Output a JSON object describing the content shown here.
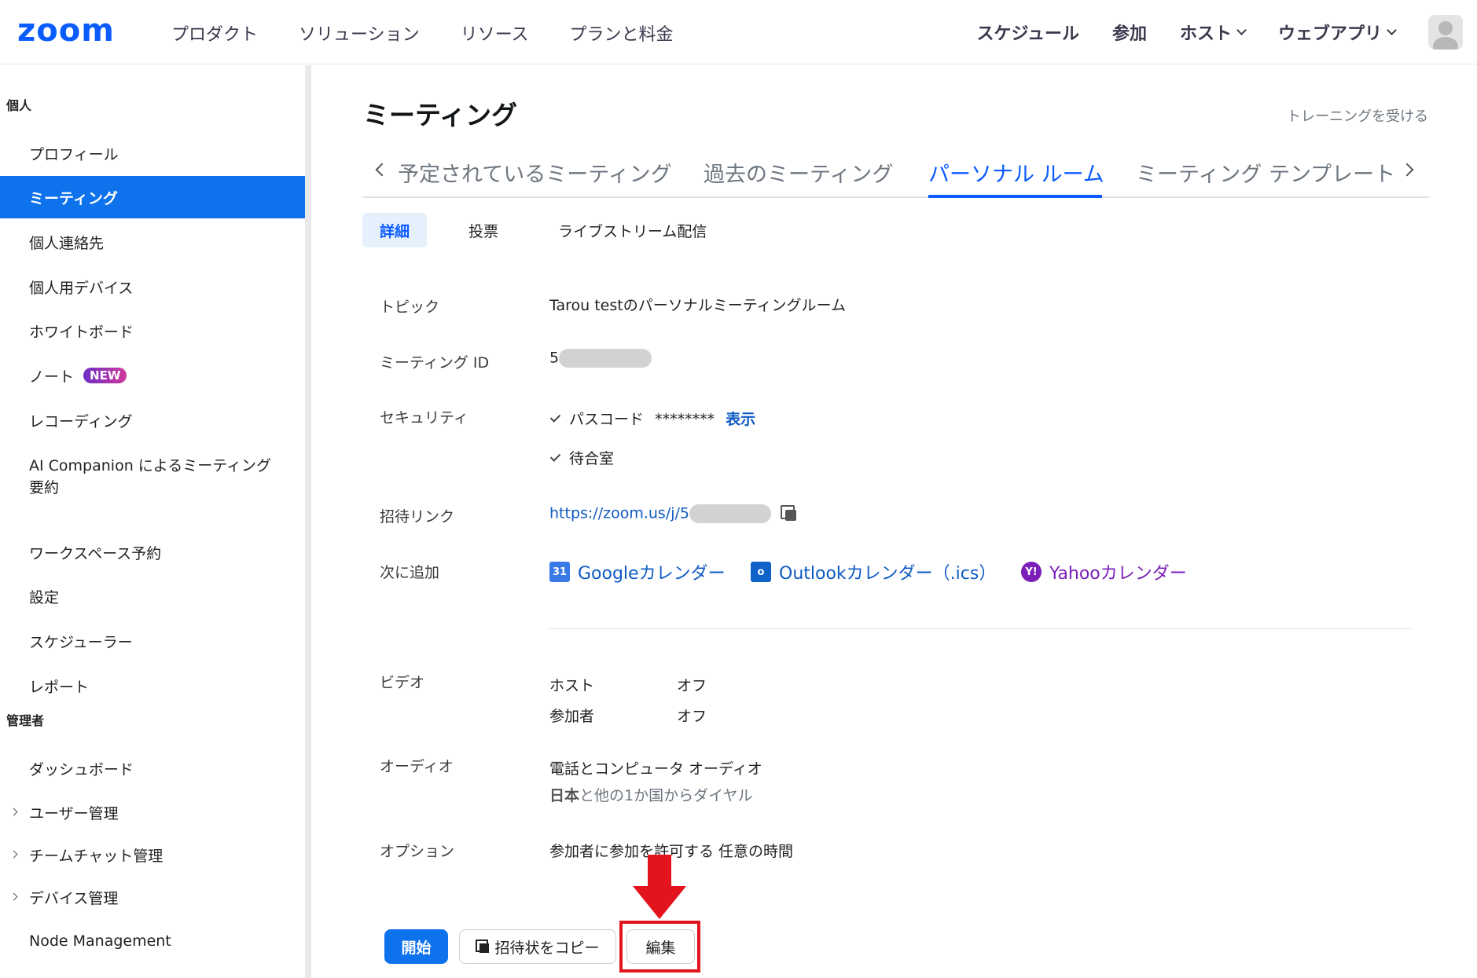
{
  "topnav": {
    "logo": "zoom",
    "links": [
      "プロダクト",
      "ソリューション",
      "リソース",
      "プランと料金"
    ],
    "right": {
      "schedule": "スケジュール",
      "join": "参加",
      "host": "ホスト",
      "webapp": "ウェブアプリ"
    }
  },
  "sidebar": {
    "personal_title": "個人",
    "items": [
      "プロフィール",
      "ミーティング",
      "個人連絡先",
      "個人用デバイス",
      "ホワイトボード",
      "ノート",
      "レコーディング",
      "AI Companion によるミーティング要約",
      "ワークスペース予約",
      "設定",
      "スケジューラー",
      "レポート"
    ],
    "new_badge": "NEW",
    "admin_title": "管理者",
    "admin_items": [
      "ダッシュボード",
      "ユーザー管理",
      "チームチャット管理",
      "デバイス管理",
      "Node Management"
    ]
  },
  "main": {
    "title": "ミーティング",
    "training_link": "トレーニングを受ける",
    "tabs": [
      "予定されているミーティング",
      "過去のミーティング",
      "パーソナル ルーム",
      "ミーティング テンプレート"
    ],
    "active_tab": "パーソナル ルーム",
    "subtabs": [
      "詳細",
      "投票",
      "ライブストリーム配信"
    ],
    "details": {
      "topic_label": "トピック",
      "topic_value": "Tarou testのパーソナルミーティングルーム",
      "meeting_id_label": "ミーティング ID",
      "meeting_id_prefix": "5",
      "security_label": "セキュリティ",
      "passcode_label": "パスコード",
      "passcode_mask": "********",
      "passcode_show": "表示",
      "waiting_room": "待合室",
      "invite_label": "招待リンク",
      "invite_link": "https://zoom.us/j/5",
      "add_to_label": "次に追加",
      "calendars": {
        "google": "Googleカレンダー",
        "outlook": "Outlookカレンダー（.ics）",
        "yahoo": "Yahooカレンダー"
      },
      "video_label": "ビデオ",
      "video_host_label": "ホスト",
      "video_host_value": "オフ",
      "video_participant_label": "参加者",
      "video_participant_value": "オフ",
      "audio_label": "オーディオ",
      "audio_value": "電話とコンピュータ オーディオ",
      "audio_country_bold": "日本",
      "audio_country_rest": "と他の1か国からダイヤル",
      "options_label": "オプション",
      "options_value": "参加者に参加を許可する 任意の時間"
    },
    "buttons": {
      "start": "開始",
      "copy_invite": "招待状をコピー",
      "edit": "編集"
    }
  },
  "colors": {
    "accent": "#0b5cff",
    "active_bg": "#0e72ed",
    "annotation_red": "#e3141d"
  }
}
